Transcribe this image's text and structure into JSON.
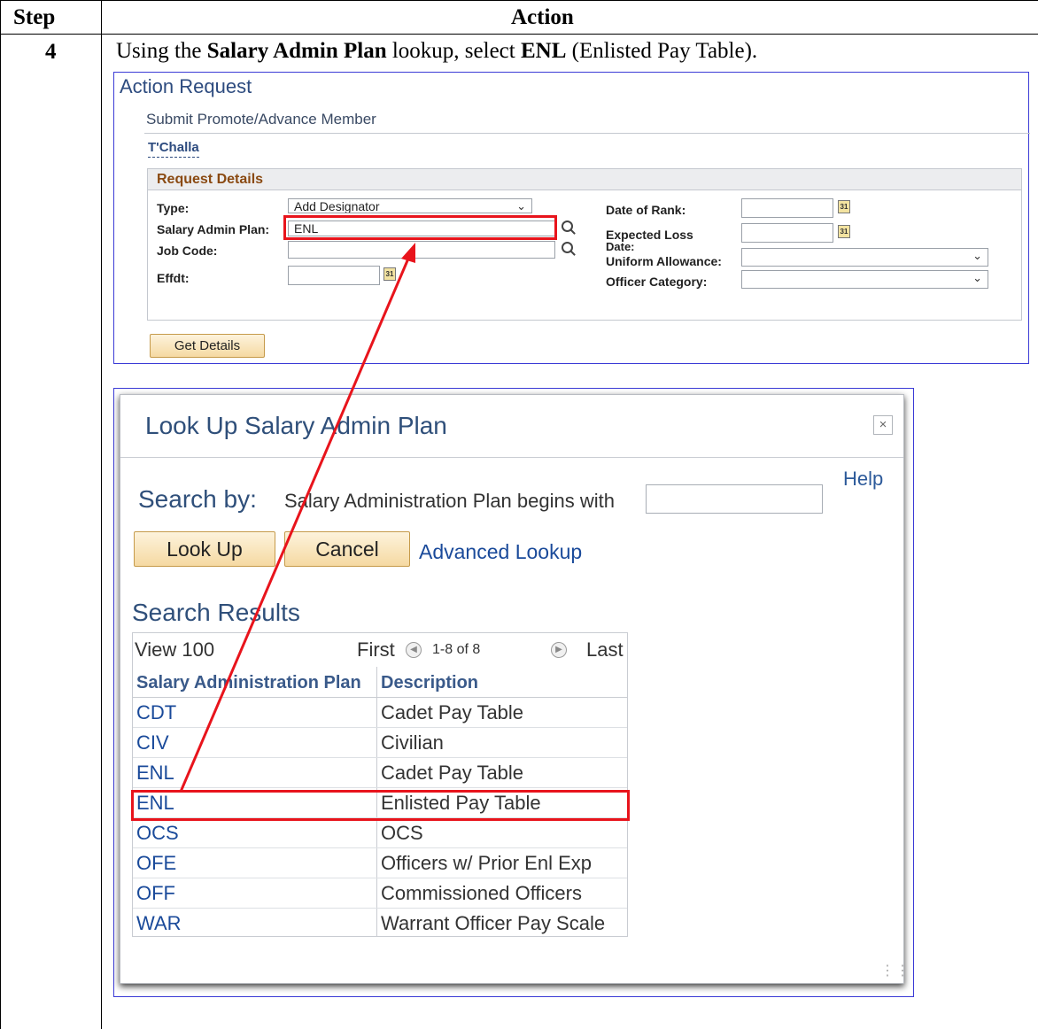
{
  "doc": {
    "header_step": "Step",
    "header_action": "Action",
    "step_number": "4",
    "instruction": {
      "part1": "Using the ",
      "bold1": "Salary Admin Plan",
      "part2": " lookup, select ",
      "bold2": "ENL",
      "part3": " (Enlisted Pay Table)."
    }
  },
  "action_request": {
    "title": "Action Request",
    "subtitle": "Submit Promote/Advance Member",
    "employee_name": "T'Challa",
    "section_title": "Request Details",
    "fields": {
      "type_label": "Type:",
      "type_value": "Add Designator",
      "salary_plan_label": "Salary Admin Plan:",
      "salary_plan_value": "ENL",
      "job_code_label": "Job Code:",
      "job_code_value": "",
      "effdt_label": "Effdt:",
      "effdt_value": "",
      "date_of_rank_label": "Date of Rank:",
      "date_of_rank_value": "",
      "expected_loss_label_line1": "Expected Loss",
      "expected_loss_label_line2": "Date:",
      "expected_loss_value": "",
      "uniform_allowance_label": "Uniform Allowance:",
      "uniform_allowance_value": "",
      "officer_category_label": "Officer Category:",
      "officer_category_value": ""
    },
    "calendar_glyph": "31",
    "get_details_label": "Get Details"
  },
  "lookup": {
    "title": "Look Up Salary Admin Plan",
    "close_glyph": "×",
    "help_label": "Help",
    "search_by_label": "Search by:",
    "criteria_text": "Salary Administration Plan begins with",
    "search_value": "",
    "look_up_label": "Look Up",
    "cancel_label": "Cancel",
    "advanced_lookup_label": "Advanced Lookup",
    "results_title": "Search Results",
    "nav": {
      "view_label": "View 100",
      "first_label": "First",
      "range_label": "1-8 of 8",
      "last_label": "Last"
    },
    "columns": [
      "Salary Administration Plan",
      "Description"
    ],
    "rows": [
      {
        "plan": "CDT",
        "description": "Cadet Pay Table"
      },
      {
        "plan": "CIV",
        "description": "Civilian"
      },
      {
        "plan": "ENL",
        "description": "Cadet Pay Table"
      },
      {
        "plan": "ENL",
        "description": "Enlisted Pay Table"
      },
      {
        "plan": "OCS",
        "description": "OCS"
      },
      {
        "plan": "OFE",
        "description": "Officers w/ Prior Enl Exp"
      },
      {
        "plan": "OFF",
        "description": "Commissioned Officers"
      },
      {
        "plan": "WAR",
        "description": "Warrant Officer Pay Scale"
      }
    ]
  },
  "colors": {
    "highlight": "#e8141c",
    "link": "#1a4a9a",
    "frame": "#3b3bd6"
  }
}
